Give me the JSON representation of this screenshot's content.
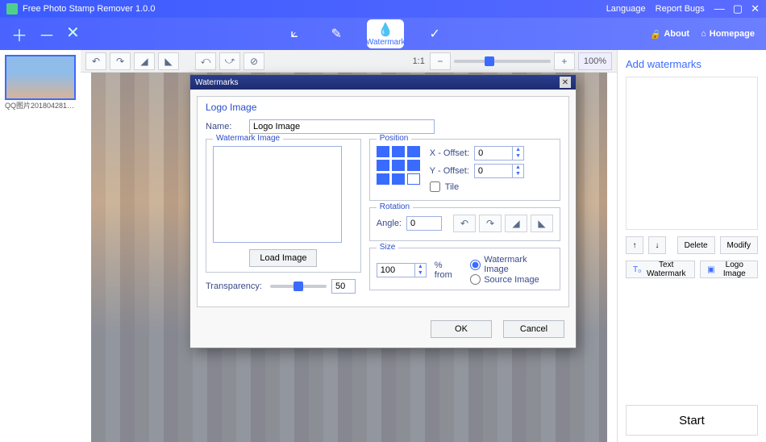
{
  "app": {
    "title": "Free Photo Stamp Remover 1.0.0"
  },
  "titlebar": {
    "language": "Language",
    "report": "Report Bugs"
  },
  "ribbon": {
    "watermark_label": "Watermark",
    "about": "About",
    "homepage": "Homepage"
  },
  "thumb": {
    "caption": "QQ图片2018042812..."
  },
  "toolbar": {
    "zoom_1_1": "1:1",
    "zoom_pct": "100%"
  },
  "side": {
    "heading": "Add watermarks",
    "delete": "Delete",
    "modify": "Modify",
    "text_wm": "Text Watermark",
    "logo_img": "Logo Image",
    "start": "Start"
  },
  "dialog": {
    "title": "Watermarks",
    "section": "Logo Image",
    "name_label": "Name:",
    "name_value": "Logo Image",
    "wm_image_legend": "Watermark Image",
    "load_image": "Load Image",
    "transparency_label": "Transparency:",
    "transparency_value": "50",
    "position_legend": "Position",
    "x_offset": "X - Offset:",
    "x_value": "0",
    "y_offset": "Y - Offset:",
    "y_value": "0",
    "tile": "Tile",
    "rotation_legend": "Rotation",
    "angle_label": "Angle:",
    "angle_value": "0",
    "size_legend": "Size",
    "size_value": "100",
    "pct_from": "% from",
    "opt_wm": "Watermark Image",
    "opt_src": "Source Image",
    "ok": "OK",
    "cancel": "Cancel"
  }
}
